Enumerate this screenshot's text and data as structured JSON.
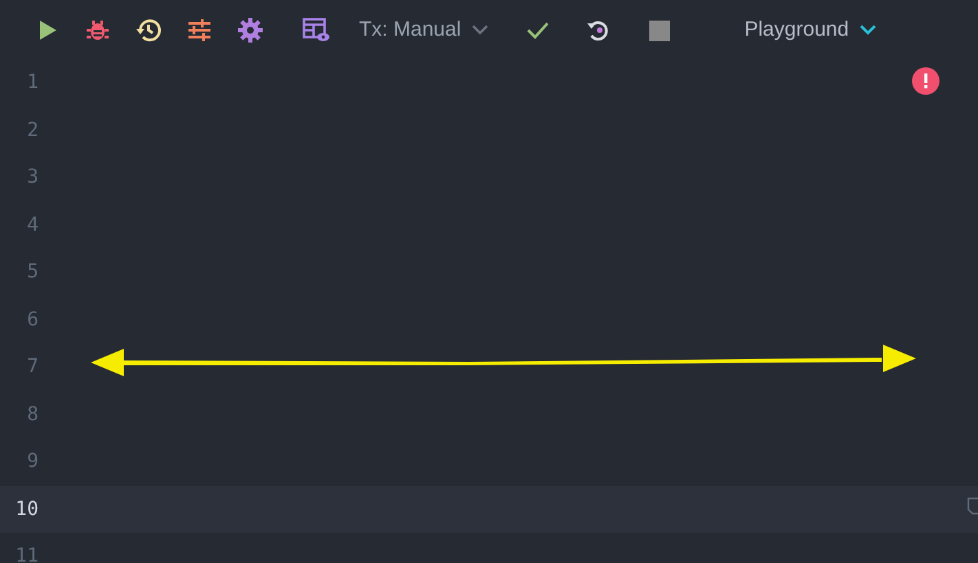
{
  "toolbar": {
    "actions": [
      {
        "kind": "run"
      },
      {
        "kind": "debug"
      },
      {
        "kind": "history"
      },
      {
        "kind": "settings-sliders"
      },
      {
        "kind": "gear"
      },
      {
        "kind": "table-view"
      }
    ],
    "transaction_mode": {
      "label": "Tx: Manual"
    },
    "commit_actions": [
      {
        "kind": "commit"
      },
      {
        "kind": "rollback"
      },
      {
        "kind": "stop",
        "disabled": true
      }
    ],
    "schema": {
      "label": "Playground"
    }
  },
  "editor": {
    "has_error": true,
    "lines": [
      {
        "number": "1",
        "current": false
      },
      {
        "number": "2",
        "current": false
      },
      {
        "number": "3",
        "current": false
      },
      {
        "number": "4",
        "current": false
      },
      {
        "number": "5",
        "current": false
      },
      {
        "number": "6",
        "current": false
      },
      {
        "number": "7",
        "current": false
      },
      {
        "number": "8",
        "current": false
      },
      {
        "number": "9",
        "current": false
      },
      {
        "number": "10",
        "current": true
      },
      {
        "number": "11",
        "current": false
      }
    ]
  }
}
